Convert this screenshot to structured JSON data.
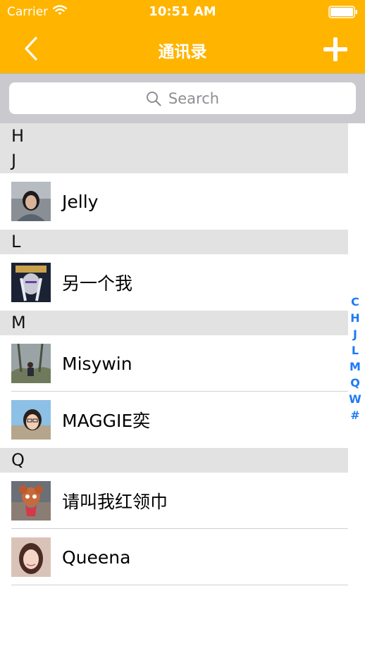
{
  "status_bar": {
    "carrier": "Carrier",
    "time": "10:51 AM"
  },
  "nav": {
    "title": "通讯录",
    "back_icon": "chevron-left-icon",
    "add_icon": "plus-icon"
  },
  "search": {
    "placeholder": "Search"
  },
  "sections": [
    {
      "letter": "H"
    },
    {
      "letter": "J",
      "contacts": [
        {
          "name": "Jelly"
        }
      ]
    },
    {
      "letter": "L",
      "contacts": [
        {
          "name": "另一个我"
        }
      ]
    },
    {
      "letter": "M",
      "contacts": [
        {
          "name": "Misywin"
        },
        {
          "name": "MAGGIE奕"
        }
      ]
    },
    {
      "letter": "Q",
      "contacts": [
        {
          "name": "请叫我红领巾"
        },
        {
          "name": "Queena"
        }
      ]
    }
  ],
  "index": [
    "C",
    "H",
    "J",
    "L",
    "M",
    "Q",
    "W",
    "#"
  ],
  "colors": {
    "nav_background": "#FFB400",
    "index_text": "#1E7BF5",
    "section_background": "#E2E2E2",
    "search_background": "#C9C9CE"
  }
}
